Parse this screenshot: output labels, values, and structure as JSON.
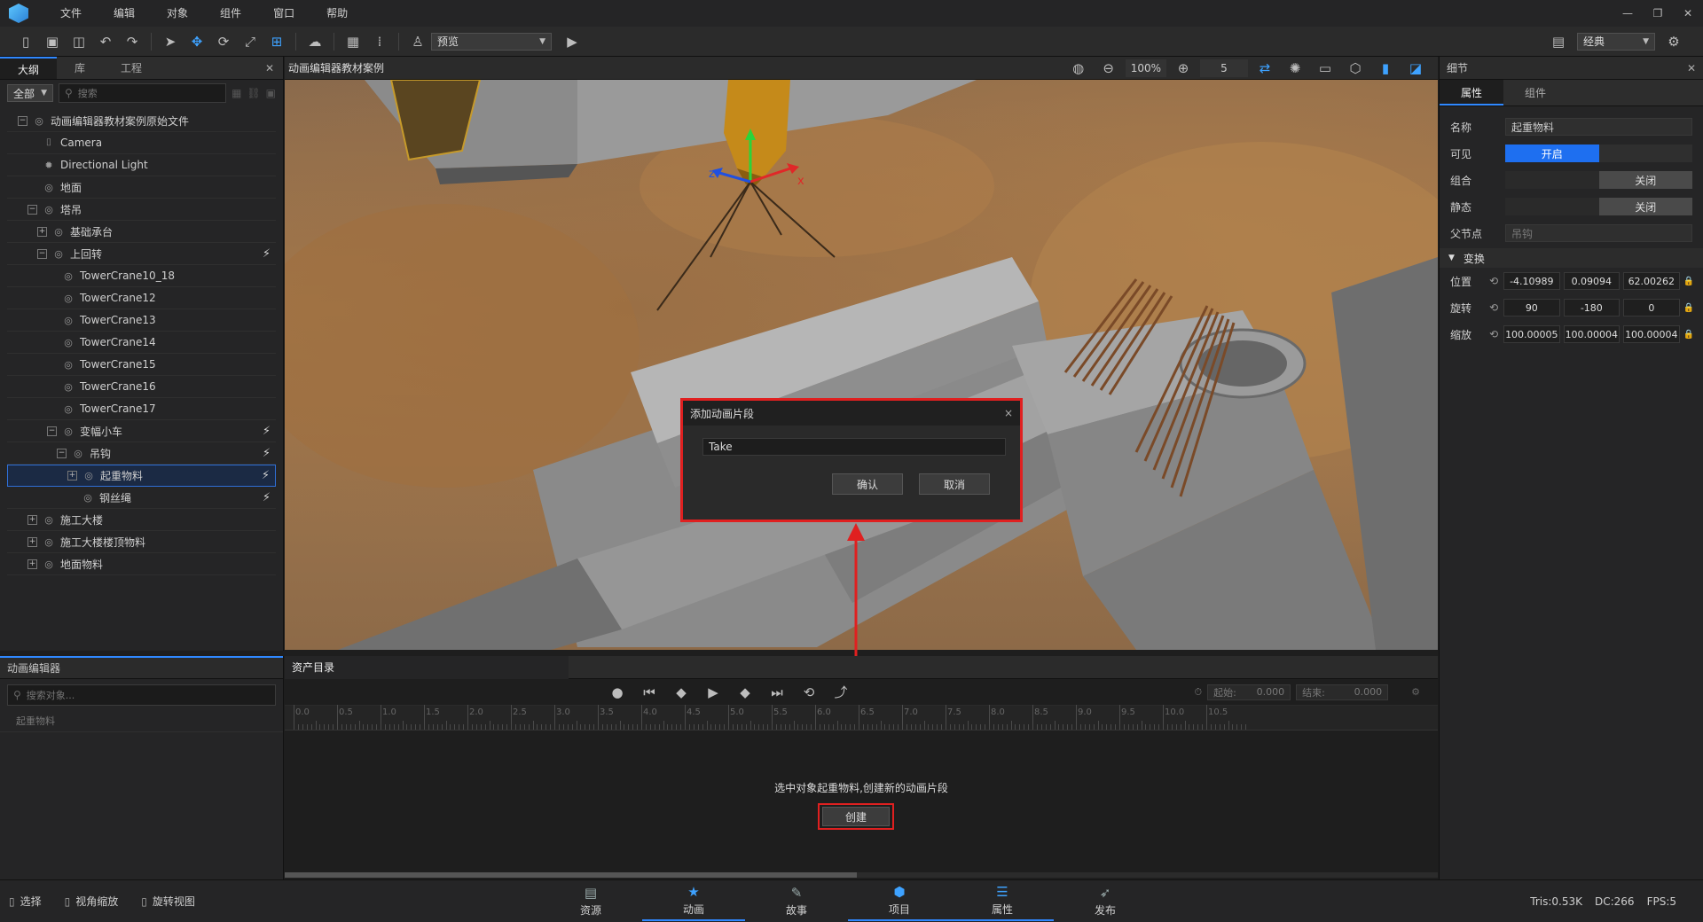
{
  "menu": [
    "文件",
    "编辑",
    "对象",
    "组件",
    "窗口",
    "帮助"
  ],
  "window_controls": [
    "—",
    "❐",
    "✕"
  ],
  "toolbar": {
    "preview_label": "预览",
    "layout_label": "经典"
  },
  "left_panel": {
    "tabs": [
      "大纲",
      "库",
      "工程"
    ],
    "filter_label": "全部",
    "search_placeholder": "搜索",
    "tree": [
      {
        "label": "动画编辑器教材案例原始文件",
        "depth": 0,
        "exp": "−",
        "icon": "eye-icon",
        "anim": false
      },
      {
        "label": "Camera",
        "depth": 1,
        "exp": "",
        "icon": "camera-icon",
        "anim": false
      },
      {
        "label": "Directional Light",
        "depth": 1,
        "exp": "",
        "icon": "light-icon",
        "anim": false
      },
      {
        "label": "地面",
        "depth": 1,
        "exp": "",
        "icon": "eye-icon",
        "anim": false
      },
      {
        "label": "塔吊",
        "depth": 1,
        "exp": "−",
        "icon": "eye-icon",
        "anim": false
      },
      {
        "label": "基础承台",
        "depth": 2,
        "exp": "+",
        "icon": "eye-icon",
        "anim": false
      },
      {
        "label": "上回转",
        "depth": 2,
        "exp": "−",
        "icon": "eye-icon",
        "anim": true
      },
      {
        "label": "TowerCrane10_18",
        "depth": 3,
        "exp": "",
        "icon": "eye-icon",
        "anim": false
      },
      {
        "label": "TowerCrane12",
        "depth": 3,
        "exp": "",
        "icon": "eye-icon",
        "anim": false
      },
      {
        "label": "TowerCrane13",
        "depth": 3,
        "exp": "",
        "icon": "eye-icon",
        "anim": false
      },
      {
        "label": "TowerCrane14",
        "depth": 3,
        "exp": "",
        "icon": "eye-icon",
        "anim": false
      },
      {
        "label": "TowerCrane15",
        "depth": 3,
        "exp": "",
        "icon": "eye-icon",
        "anim": false
      },
      {
        "label": "TowerCrane16",
        "depth": 3,
        "exp": "",
        "icon": "eye-icon",
        "anim": false
      },
      {
        "label": "TowerCrane17",
        "depth": 3,
        "exp": "",
        "icon": "eye-icon",
        "anim": false
      },
      {
        "label": "变幅小车",
        "depth": 3,
        "exp": "−",
        "icon": "eye-icon",
        "anim": true
      },
      {
        "label": "吊钩",
        "depth": 4,
        "exp": "−",
        "icon": "eye-icon",
        "anim": true
      },
      {
        "label": "起重物料",
        "depth": 5,
        "exp": "+",
        "icon": "eye-icon",
        "anim": true,
        "selected": true
      },
      {
        "label": "钢丝绳",
        "depth": 5,
        "exp": "",
        "icon": "eye-icon",
        "anim": true
      },
      {
        "label": "施工大楼",
        "depth": 1,
        "exp": "+",
        "icon": "eye-icon",
        "anim": false
      },
      {
        "label": "施工大楼楼顶物料",
        "depth": 1,
        "exp": "+",
        "icon": "eye-icon",
        "anim": false
      },
      {
        "label": "地面物料",
        "depth": 1,
        "exp": "+",
        "icon": "eye-icon",
        "anim": false
      }
    ]
  },
  "viewport": {
    "title": "动画编辑器教材案例",
    "zoom": "100%",
    "speed": "5"
  },
  "dialog": {
    "title": "添加动画片段",
    "close": "×",
    "input_value": "Take",
    "confirm_label": "确认",
    "cancel_label": "取消"
  },
  "right_panel": {
    "header": "细节",
    "tabs": [
      "属性",
      "组件"
    ],
    "name_label": "名称",
    "name_value": "起重物料",
    "visible_label": "可见",
    "visible_on": "开启",
    "group_label": "组合",
    "group_off": "关闭",
    "static_label": "静态",
    "static_off": "关闭",
    "parent_label": "父节点",
    "parent_value": "吊钩",
    "transform_label": "变换",
    "position_label": "位置",
    "position": [
      "-4.10989",
      "0.09094",
      "62.00262"
    ],
    "rotation_label": "旋转",
    "rotation": [
      "90",
      "-180",
      "0"
    ],
    "scale_label": "缩放",
    "scale": [
      "100.00005",
      "100.00004",
      "100.00004"
    ]
  },
  "anim_editor": {
    "title": "动画编辑器",
    "search_placeholder": "搜索对象...",
    "object_label": "起重物料",
    "asset_tab": "资产目录",
    "start_label": "起始:",
    "start_value": "0.000",
    "end_label": "结束:",
    "end_value": "0.000",
    "ticks": [
      "0.0",
      "0.5",
      "1.0",
      "1.5",
      "2.0",
      "2.5",
      "3.0",
      "3.5",
      "4.0",
      "4.5",
      "5.0",
      "5.5",
      "6.0",
      "6.5",
      "7.0",
      "7.5",
      "8.0",
      "8.5",
      "9.0",
      "9.5",
      "10.0",
      "10.5"
    ],
    "hint": "选中对象起重物料,创建新的动画片段",
    "create_label": "创建"
  },
  "status": {
    "select": "选择",
    "zoom_view": "视角缩放",
    "rotate_view": "旋转视图",
    "tabs": [
      "资源",
      "动画",
      "故事",
      "项目",
      "属性",
      "发布"
    ],
    "tris": "Tris:0.53K",
    "dc": "DC:266",
    "fps": "FPS:5"
  },
  "colors": {
    "accent": "#2f88ff",
    "highlight_red": "#e02020",
    "toggle_on": "#1e6ff0"
  }
}
